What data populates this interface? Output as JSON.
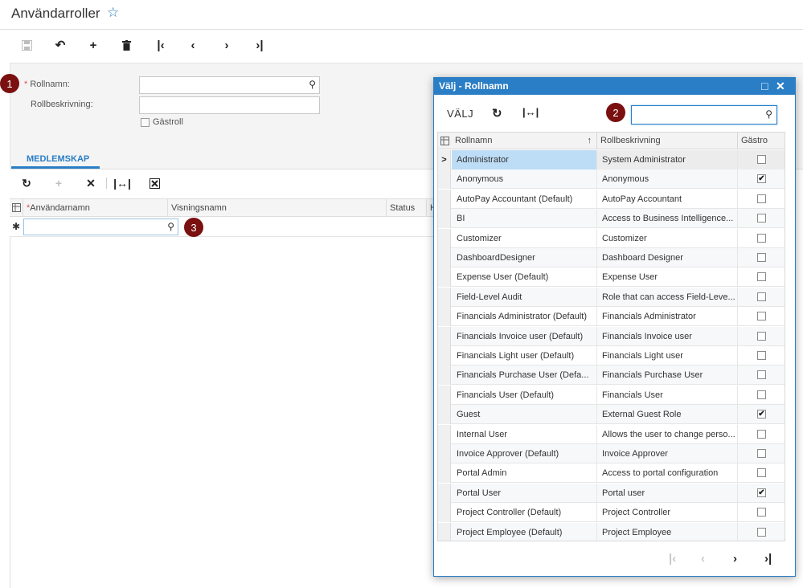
{
  "page": {
    "title": "Användarroller",
    "star_icon": "star-icon"
  },
  "toolbar": {
    "items": [
      "save-icon",
      "undo-icon",
      "add-icon",
      "delete-icon",
      "first-icon",
      "prev-icon",
      "next-icon",
      "last-icon"
    ]
  },
  "form": {
    "badge1": "1",
    "role_name_required": "*",
    "role_name_label": "Rollnamn:",
    "role_name_value": "",
    "role_desc_label": "Rollbeskrivning:",
    "role_desc_value": "",
    "guest_role_label": "Gästroll"
  },
  "tabs": {
    "membership": "MEDLEMSKAP"
  },
  "members_grid": {
    "columns": {
      "username": "Användarnamn",
      "username_required": "*",
      "display_name": "Visningsnamn",
      "status": "Status",
      "truncated": "H"
    },
    "new_row_marker": "✱",
    "badge3": "3"
  },
  "dialog": {
    "title": "Välj - Rollnamn",
    "select_button": "VÄLJ",
    "badge2": "2",
    "search_value": "",
    "columns": {
      "role_name": "Rollnamn",
      "sort_indicator": "↑",
      "role_desc": "Rollbeskrivning",
      "guest": "Gästro"
    },
    "rows": [
      {
        "name": "Administrator",
        "desc": "System Administrator",
        "guest": false,
        "selected": true
      },
      {
        "name": "Anonymous",
        "desc": "Anonymous",
        "guest": true
      },
      {
        "name": "AutoPay Accountant (Default)",
        "desc": "AutoPay Accountant",
        "guest": false
      },
      {
        "name": "BI",
        "desc": "Access to Business Intelligence...",
        "guest": false
      },
      {
        "name": "Customizer",
        "desc": "Customizer",
        "guest": false
      },
      {
        "name": "DashboardDesigner",
        "desc": "Dashboard Designer",
        "guest": false
      },
      {
        "name": "Expense User (Default)",
        "desc": "Expense User",
        "guest": false
      },
      {
        "name": "Field-Level Audit",
        "desc": "Role that can access Field-Leve...",
        "guest": false
      },
      {
        "name": "Financials Administrator (Default)",
        "desc": "Financials Administrator",
        "guest": false
      },
      {
        "name": "Financials Invoice user (Default)",
        "desc": "Financials Invoice user",
        "guest": false
      },
      {
        "name": "Financials Light user (Default)",
        "desc": "Financials Light user",
        "guest": false
      },
      {
        "name": "Financials Purchase User (Defa...",
        "desc": "Financials Purchase User",
        "guest": false
      },
      {
        "name": "Financials User (Default)",
        "desc": "Financials User",
        "guest": false
      },
      {
        "name": "Guest",
        "desc": "External Guest Role",
        "guest": true
      },
      {
        "name": "Internal User",
        "desc": "Allows the user to change perso...",
        "guest": false
      },
      {
        "name": "Invoice Approver (Default)",
        "desc": "Invoice Approver",
        "guest": false
      },
      {
        "name": "Portal Admin",
        "desc": "Access to portal configuration",
        "guest": false
      },
      {
        "name": "Portal User",
        "desc": "Portal user",
        "guest": true
      },
      {
        "name": "Project Controller (Default)",
        "desc": "Project Controller",
        "guest": false
      },
      {
        "name": "Project Employee (Default)",
        "desc": "Project Employee",
        "guest": false
      }
    ],
    "selected_row_marker": ">",
    "checkmark": "✔"
  }
}
